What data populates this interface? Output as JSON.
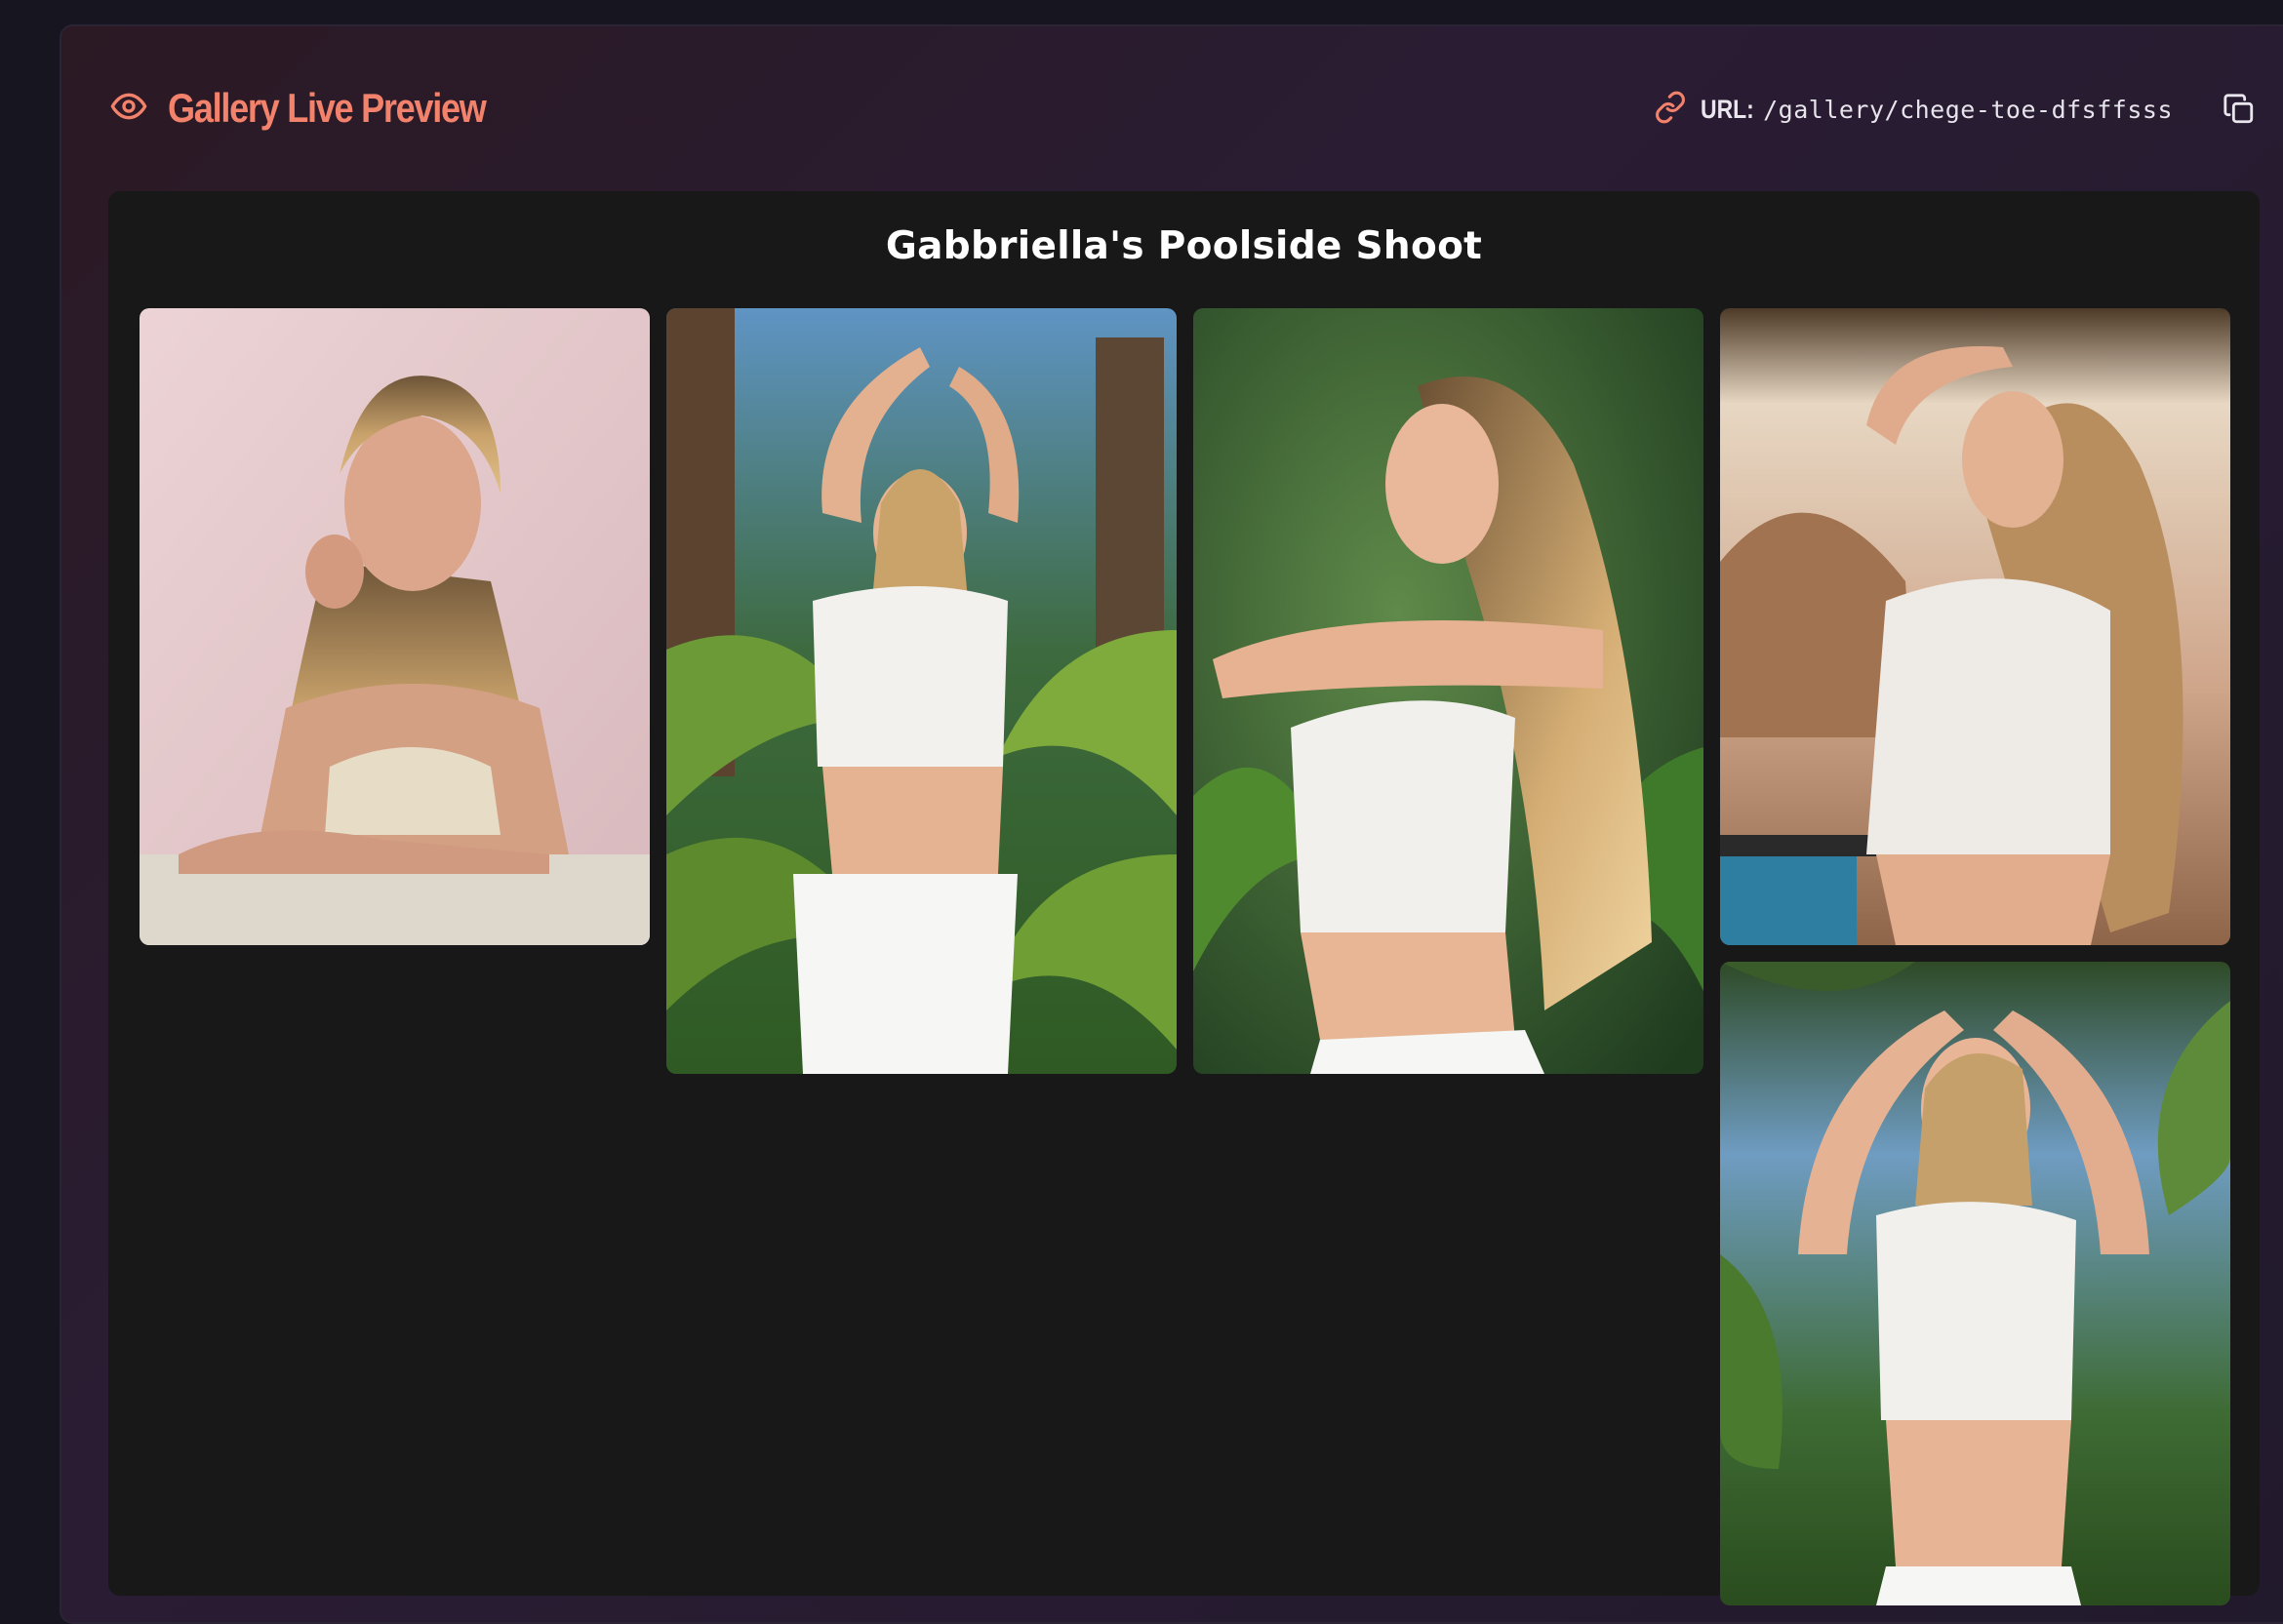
{
  "header": {
    "title": "Gallery Live Preview",
    "title_icon": "eye-icon",
    "url_label": "URL:",
    "url_value": "/gallery/chege-toe-dfsffsss",
    "url_icon": "link-icon",
    "copy_icon": "copy-icon"
  },
  "gallery": {
    "title": "Gabbriella's Poolside Shoot",
    "photos": [
      {
        "name": "photo-1",
        "background": "pink studio backdrop"
      },
      {
        "name": "photo-2",
        "background": "palm foliage"
      },
      {
        "name": "photo-3",
        "background": "green foliage"
      },
      {
        "name": "photo-4",
        "background": "poolside wall"
      },
      {
        "name": "photo-5",
        "background": "sky and trees"
      }
    ]
  },
  "colors": {
    "accent": "#f2826b",
    "panel_bg": "#181818",
    "page_bg": "#17151f"
  }
}
